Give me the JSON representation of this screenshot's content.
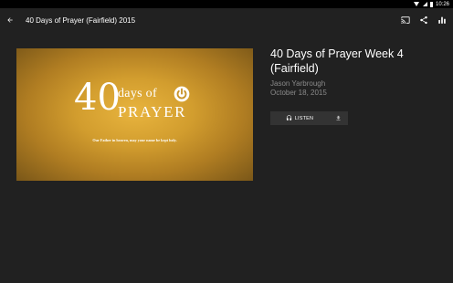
{
  "status_bar": {
    "time": "10:26",
    "icons": [
      "wifi-icon",
      "signal-icon",
      "battery-icon"
    ]
  },
  "app_bar": {
    "title": "40 Days of Prayer (Fairfield) 2015",
    "back_icon": "back-arrow-icon",
    "actions": [
      "cast-icon",
      "share-icon",
      "stats-icon"
    ]
  },
  "artwork": {
    "number": "40",
    "days_of": "days of",
    "prayer": "PRAYER",
    "tagline": "Our Father in heaven, may your name be kept holy."
  },
  "sermon": {
    "title": "40 Days of Prayer Week 4 (Fairfield)",
    "speaker": "Jason Yarbrough",
    "date": "October 18, 2015"
  },
  "actions": {
    "listen_label": "LISTEN",
    "listen_icon": "headphones-icon",
    "download_icon": "download-icon"
  },
  "colors": {
    "background": "#212121",
    "status_bar": "#000000",
    "muted_text": "#8a8a8a",
    "button_bg": "#333333",
    "artwork_gold": "#d29d2e"
  }
}
